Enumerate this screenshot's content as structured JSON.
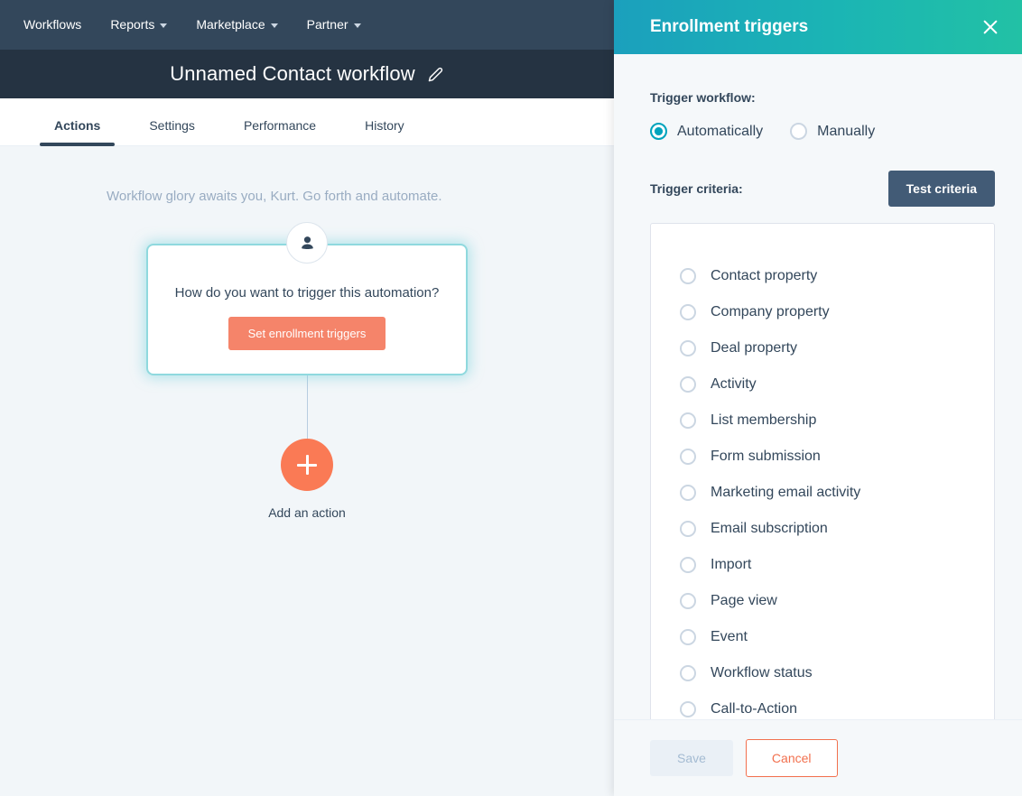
{
  "top_nav": {
    "items": [
      {
        "label": "Workflows",
        "has_caret": false
      },
      {
        "label": "Reports",
        "has_caret": true
      },
      {
        "label": "Marketplace",
        "has_caret": true
      },
      {
        "label": "Partner",
        "has_caret": true
      }
    ]
  },
  "title_bar": {
    "workflow_name": "Unnamed Contact workflow",
    "edit_icon": "pencil-icon"
  },
  "tabs": [
    {
      "label": "Actions",
      "active": true
    },
    {
      "label": "Settings",
      "active": false
    },
    {
      "label": "Performance",
      "active": false
    },
    {
      "label": "History",
      "active": false
    }
  ],
  "canvas": {
    "greeting": "Workflow glory awaits you, Kurt. Go forth and automate.",
    "trigger_card": {
      "icon": "contact-avatar-icon",
      "question": "How do you want to trigger this automation?",
      "button_label": "Set enrollment triggers"
    },
    "add_action": {
      "icon": "plus-icon",
      "label": "Add an action"
    }
  },
  "panel": {
    "title": "Enrollment triggers",
    "close_icon": "close-icon",
    "trigger_workflow_label": "Trigger workflow:",
    "trigger_workflow_options": [
      {
        "label": "Automatically",
        "selected": true
      },
      {
        "label": "Manually",
        "selected": false
      }
    ],
    "trigger_criteria_label": "Trigger criteria:",
    "test_criteria_label": "Test criteria",
    "criteria_options": [
      {
        "label": "Contact property",
        "selected": false
      },
      {
        "label": "Company property",
        "selected": false
      },
      {
        "label": "Deal property",
        "selected": false
      },
      {
        "label": "Activity",
        "selected": false
      },
      {
        "label": "List membership",
        "selected": false
      },
      {
        "label": "Form submission",
        "selected": false
      },
      {
        "label": "Marketing email activity",
        "selected": false
      },
      {
        "label": "Email subscription",
        "selected": false
      },
      {
        "label": "Import",
        "selected": false
      },
      {
        "label": "Page view",
        "selected": false
      },
      {
        "label": "Event",
        "selected": false
      },
      {
        "label": "Workflow status",
        "selected": false
      },
      {
        "label": "Call-to-Action",
        "selected": false
      }
    ],
    "footer": {
      "save_label": "Save",
      "cancel_label": "Cancel"
    }
  },
  "colors": {
    "nav_bg": "#33475B",
    "title_bg": "#253342",
    "canvas_bg": "#F2F6F9",
    "panel_header_from": "#1BA0BD",
    "panel_header_to": "#22C1A5",
    "accent_teal": "#00A4BD",
    "accent_orange": "#F5846A",
    "add_orange": "#FA7A55",
    "dark_button": "#425B76",
    "cancel_orange": "#F2704E"
  }
}
